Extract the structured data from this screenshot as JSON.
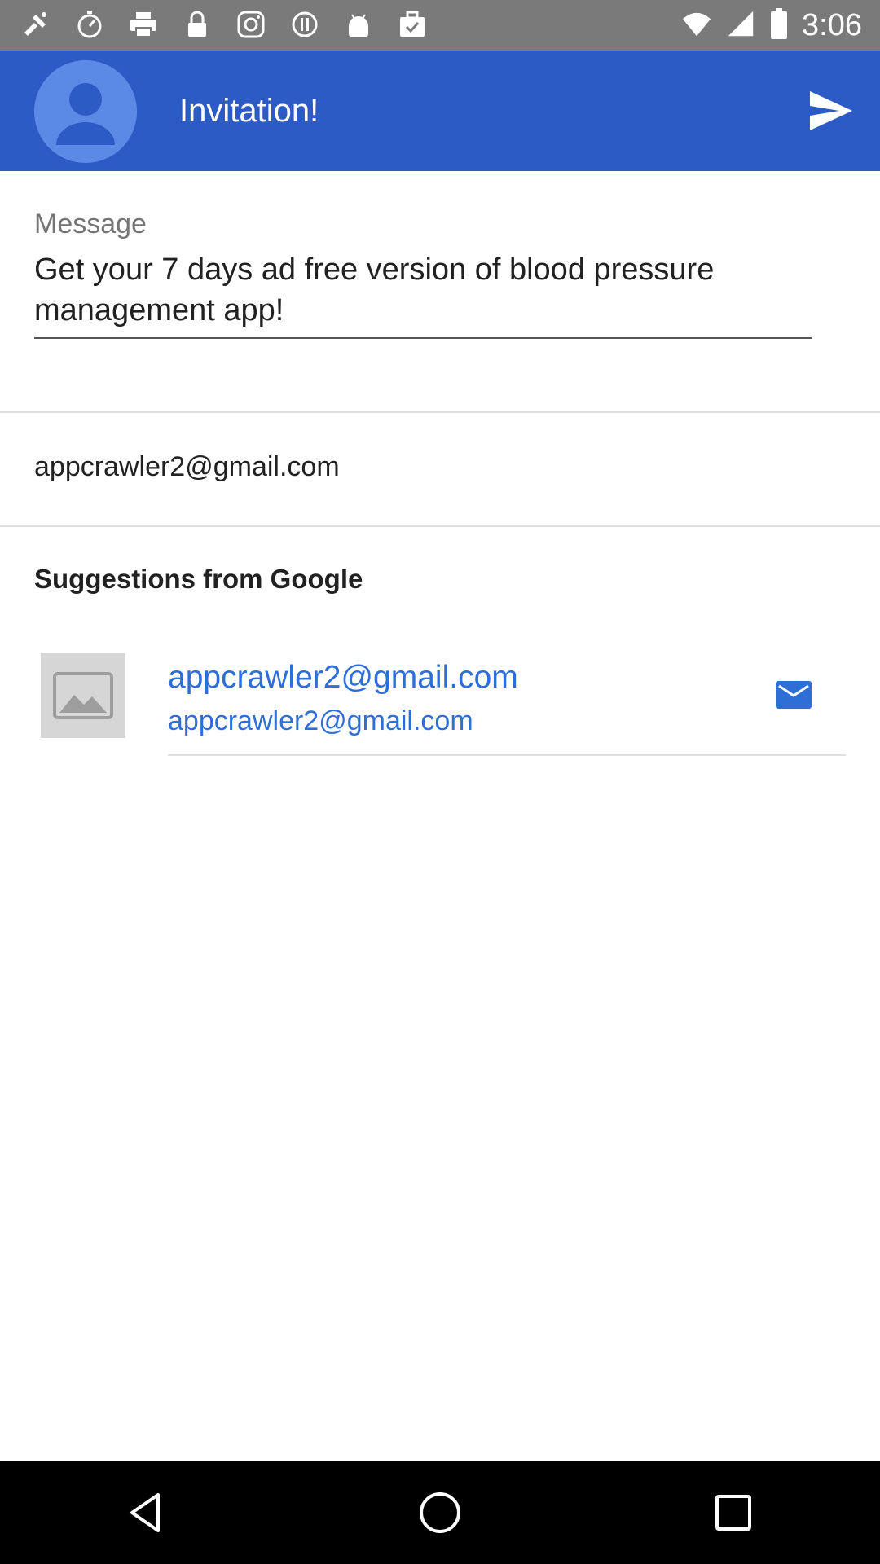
{
  "status_bar": {
    "time": "3:06",
    "icons": [
      "satellite-icon",
      "stopwatch-icon",
      "printer-icon",
      "lock-icon",
      "instagram-icon",
      "info-icon",
      "android-icon",
      "briefcase-check-icon",
      "wifi-icon",
      "signal-icon",
      "battery-icon"
    ]
  },
  "app_bar": {
    "title": "Invitation!"
  },
  "message": {
    "label": "Message",
    "value": "Get your 7 days ad free version of blood pressure management app!"
  },
  "recipient": {
    "email": "appcrawler2@gmail.com"
  },
  "suggestions": {
    "title": "Suggestions from Google",
    "items": [
      {
        "name": "appcrawler2@gmail.com",
        "email": "appcrawler2@gmail.com"
      }
    ]
  },
  "colors": {
    "app_bar": "#2d5bc6",
    "link": "#2d6fd6",
    "status_bar": "#7a7a7a"
  }
}
